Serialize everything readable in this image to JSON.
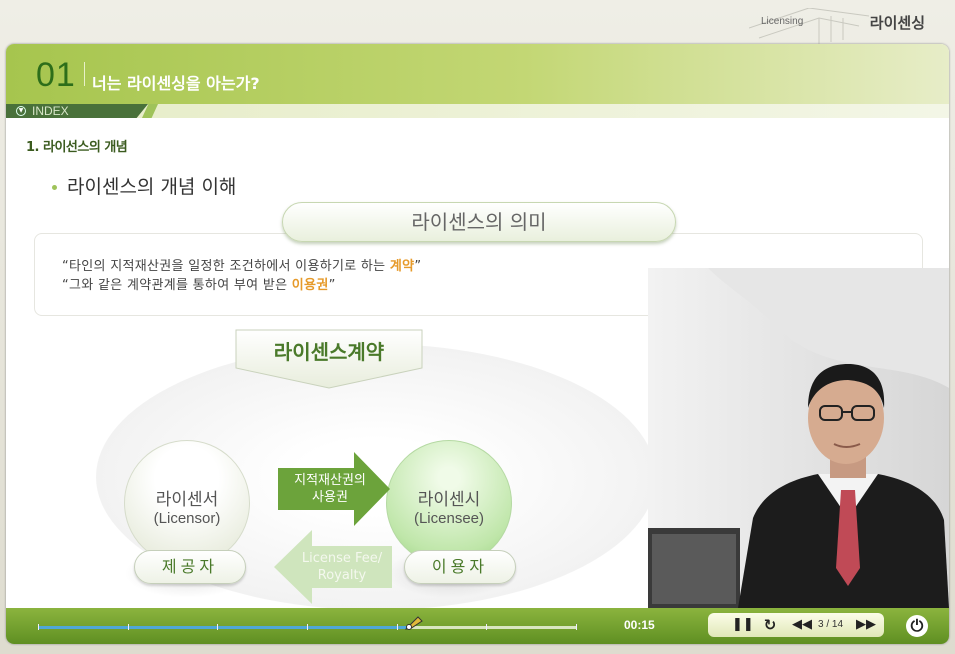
{
  "brand": {
    "en": "Licensing",
    "ko": "라이센싱"
  },
  "header": {
    "number": "01",
    "title": "너는 라이센싱을 아는가?"
  },
  "index": {
    "label": "INDEX",
    "icon": "chevron-down-icon"
  },
  "section": {
    "title": "1. 라이선스의 개념"
  },
  "subtitle": "라이센스의 개념 이해",
  "meaning": {
    "pill": "라이센스의 의미",
    "line1": {
      "text": "“타인의 지적재산권을 일정한 조건하에서 이용하기로 하는 ",
      "highlight": "계약",
      "end": "”"
    },
    "line2": {
      "text": "“그와 같은 계약관계를 통하여 부여 받은 ",
      "highlight": "이용권",
      "end": "”"
    }
  },
  "diagram": {
    "contract": "라이센스계약",
    "licensor": {
      "ko": "라이센서",
      "en": "(Licensor)"
    },
    "licensee": {
      "ko": "라이센시",
      "en": "(Licensee)"
    },
    "arrow_right": {
      "line1": "지적재산권의",
      "line2": "사용권"
    },
    "arrow_left": {
      "line1": "License Fee/",
      "line2": "Royalty"
    },
    "provider": "제공자",
    "user": "이용자"
  },
  "player": {
    "time": "00:15",
    "progress": 0.69,
    "page": "3 / 14",
    "buttons": [
      "pause-icon",
      "replay-icon",
      "rewind-icon",
      "forward-icon",
      "power-icon"
    ]
  },
  "colors": {
    "accent": "#9fc35a",
    "dark_green": "#2d6e1a",
    "highlight": "#e69a2a"
  }
}
